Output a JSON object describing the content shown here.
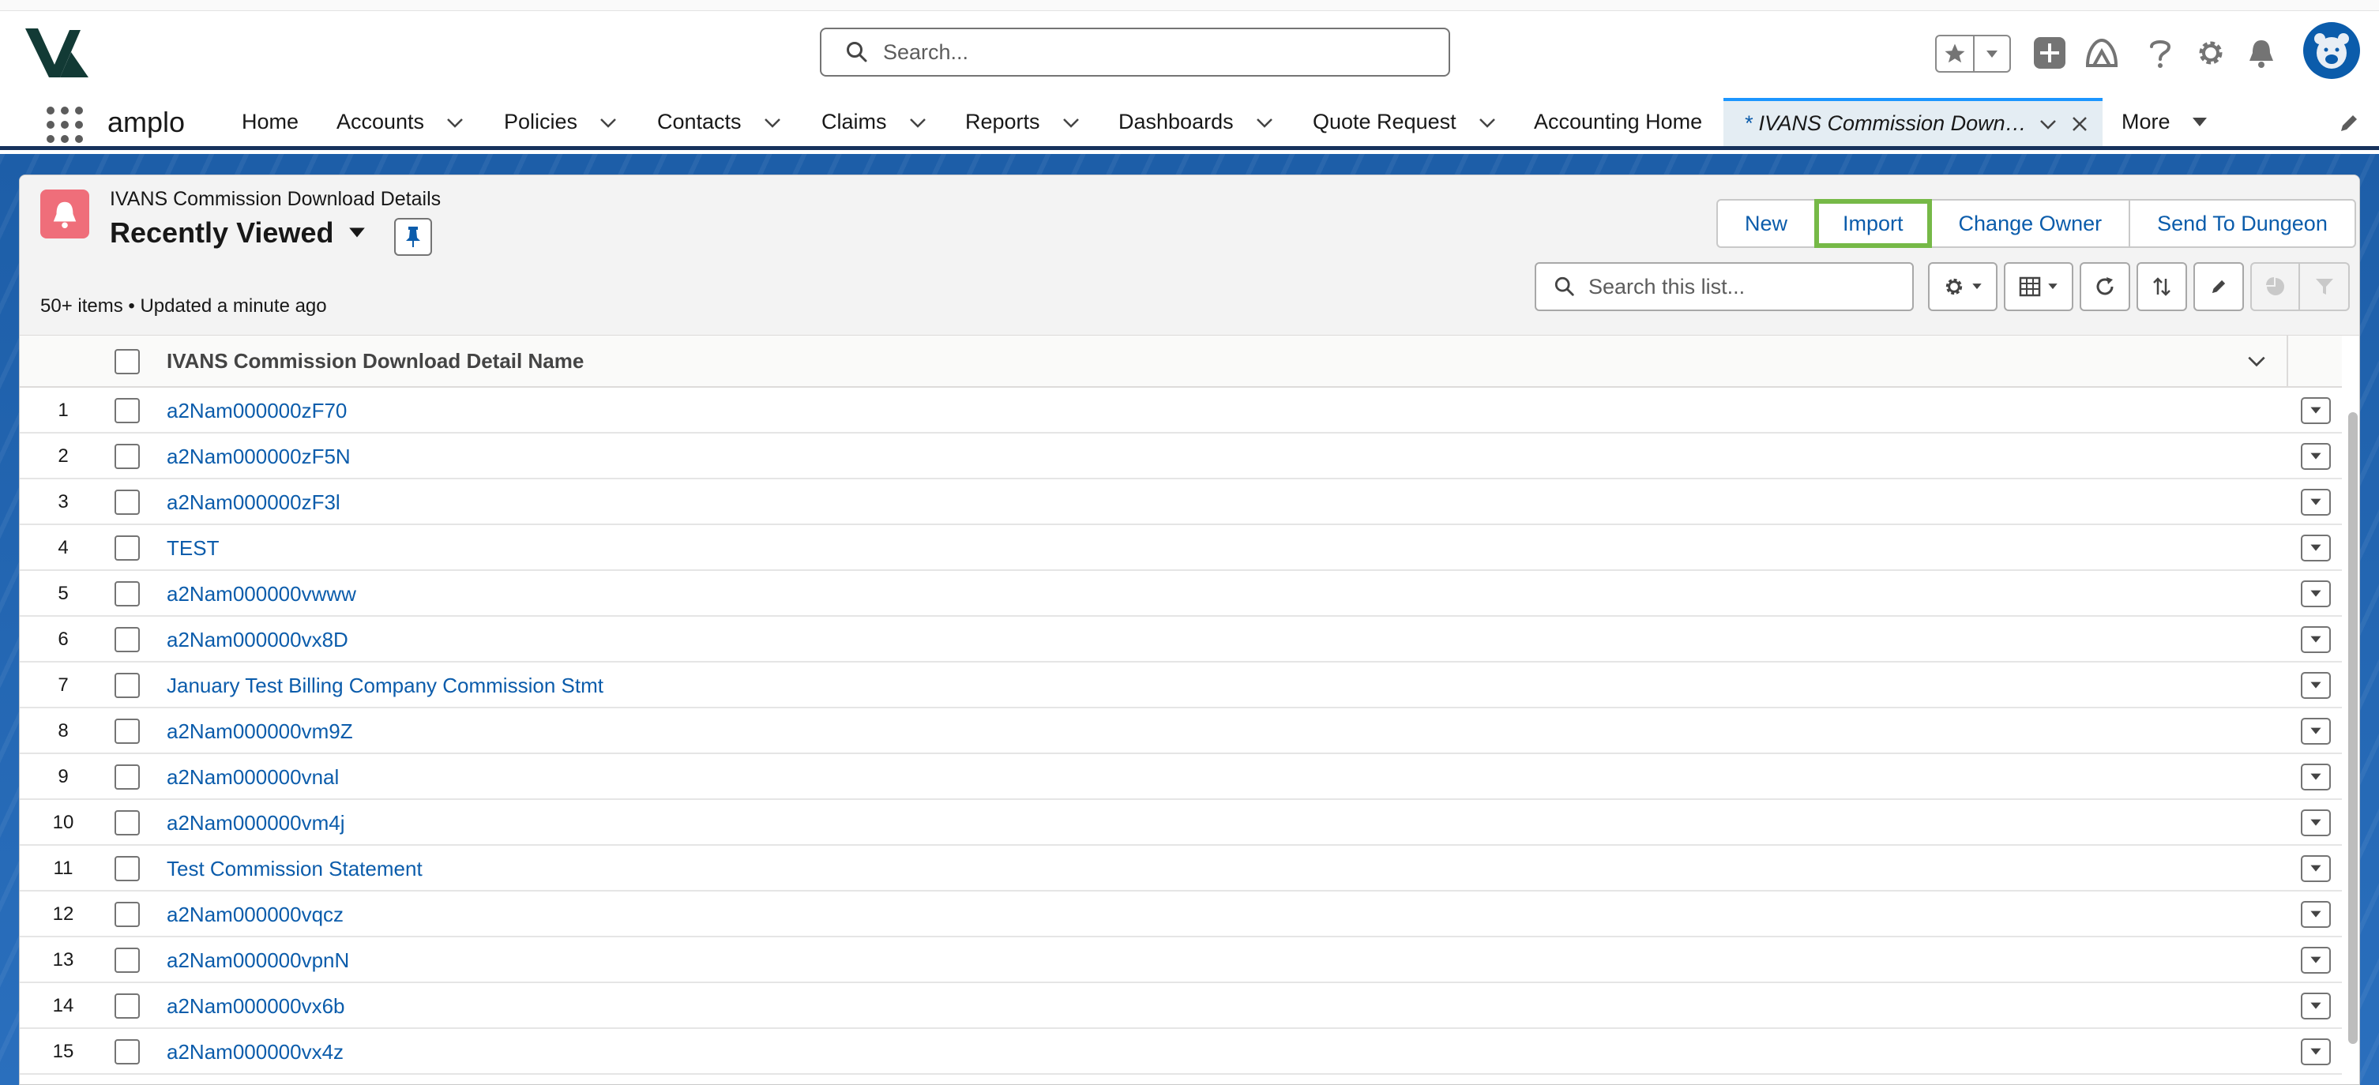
{
  "header": {
    "search_placeholder": "Search..."
  },
  "nav": {
    "app_name": "amplo",
    "items": [
      {
        "label": "Home",
        "has_menu": false
      },
      {
        "label": "Accounts",
        "has_menu": true
      },
      {
        "label": "Policies",
        "has_menu": true
      },
      {
        "label": "Contacts",
        "has_menu": true
      },
      {
        "label": "Claims",
        "has_menu": true
      },
      {
        "label": "Reports",
        "has_menu": true
      },
      {
        "label": "Dashboards",
        "has_menu": true
      },
      {
        "label": "Quote Request",
        "has_menu": true
      },
      {
        "label": "Accounting Home",
        "has_menu": false
      }
    ],
    "active_tab": {
      "prefix": "*",
      "label": "IVANS Commission Download Details"
    },
    "more_label": "More"
  },
  "list": {
    "object_label": "IVANS Commission Download Details",
    "view_name": "Recently Viewed",
    "meta": "50+ items • Updated a minute ago",
    "buttons": {
      "new": "New",
      "import": "Import",
      "change_owner": "Change Owner",
      "send_to_dungeon": "Send To Dungeon"
    },
    "search_placeholder": "Search this list...",
    "column_header": "IVANS Commission Download Detail Name",
    "rows": [
      {
        "num": "1",
        "name": "a2Nam000000zF70"
      },
      {
        "num": "2",
        "name": "a2Nam000000zF5N"
      },
      {
        "num": "3",
        "name": "a2Nam000000zF3l"
      },
      {
        "num": "4",
        "name": "TEST"
      },
      {
        "num": "5",
        "name": "a2Nam000000vwww"
      },
      {
        "num": "6",
        "name": "a2Nam000000vx8D"
      },
      {
        "num": "7",
        "name": "January Test Billing Company Commission Stmt"
      },
      {
        "num": "8",
        "name": "a2Nam000000vm9Z"
      },
      {
        "num": "9",
        "name": "a2Nam000000vnal"
      },
      {
        "num": "10",
        "name": "a2Nam000000vm4j"
      },
      {
        "num": "11",
        "name": "Test Commission Statement"
      },
      {
        "num": "12",
        "name": "a2Nam000000vqcz"
      },
      {
        "num": "13",
        "name": "a2Nam000000vpnN"
      },
      {
        "num": "14",
        "name": "a2Nam000000vx6b"
      },
      {
        "num": "15",
        "name": "a2Nam000000vx4z"
      }
    ]
  },
  "colors": {
    "brand_blue": "#0b5cab",
    "nav_border": "#16325c",
    "object_icon": "#ef6e7a",
    "highlight": "#76b947",
    "banner": "#1d5ea8"
  },
  "icons": {
    "logo": "amplo-logo",
    "search": "search-icon",
    "favorites": "star-icon",
    "global_actions": "plus-icon",
    "trailhead": "trailhead-icon",
    "help": "help-icon",
    "setup": "gear-icon",
    "notifications": "bell-icon",
    "avatar": "user-avatar",
    "object": "bell-icon"
  }
}
